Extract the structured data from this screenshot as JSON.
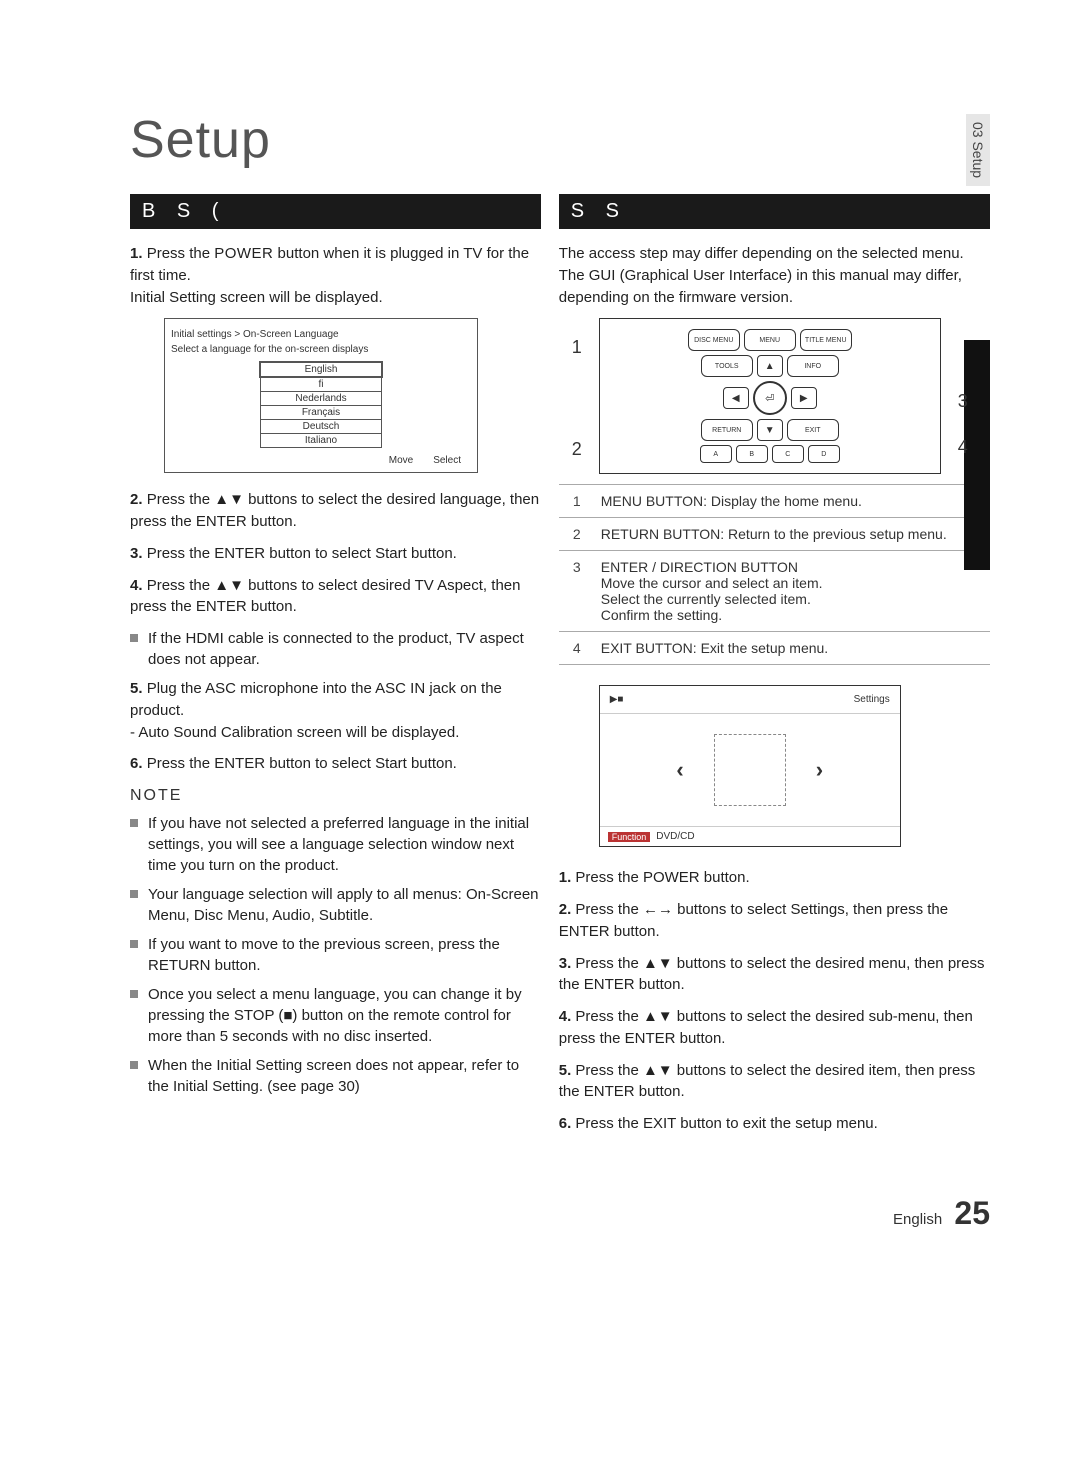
{
  "title": "Setup",
  "side_tab": "03  Setup",
  "left": {
    "bar": "B      S         (",
    "step1_a": "Press the ",
    "power": "POWER",
    "step1_b": " button when it is plugged in TV for the ﬁrst time.",
    "step1_c": "Initial Setting screen will be displayed.",
    "lang": {
      "crumb": "Initial settings > On-Screen Language",
      "instr": "Select a language for the on-screen displays",
      "items": [
        "English",
        "ﬁ",
        "Nederlands",
        "Français",
        "Deutsch",
        "Italiano"
      ],
      "move": "Move",
      "select": "Select"
    },
    "step2": "Press the ▲▼ buttons to select the desired language, then press the ENTER button.",
    "step3": "Press the ENTER button to select Start button.",
    "step4": "Press the ▲▼ buttons to select desired TV Aspect, then press the ENTER button.",
    "step4_note": "If the HDMI cable is connected to the product, TV aspect does not appear.",
    "step5_a": "Plug the ASC microphone into the ASC IN jack on the product.",
    "step5_b": "- Auto Sound Calibration screen will be displayed.",
    "step6": "Press the ENTER button to select Start button.",
    "note_label": "NOTE",
    "notes": [
      "If you have not selected a preferred language in the initial settings, you will see a language selection window next time you turn on the product.",
      "Your language selection will apply to all menus: On-Screen Menu, Disc Menu, Audio, Subtitle.",
      "If you want to move to the previous screen, press the RETURN button.",
      "Once you select a menu language, you can change it by pressing the STOP (■) button on the remote control for more than 5 seconds with no disc inserted.",
      "When the Initial Setting screen does not appear, refer to the Initial Setting. (see page 30)"
    ]
  },
  "right": {
    "bar": "S               S",
    "intro": "The access step may differ depending on the selected menu. The GUI (Graphical User Interface) in this manual may differ, depending on the ﬁrmware version.",
    "remote": {
      "disc_menu": "DISC MENU",
      "menu": "MENU",
      "title_menu": "TITLE MENU",
      "tools": "TOOLS",
      "info": "INFO",
      "return": "RETURN",
      "exit": "EXIT",
      "abcd": [
        "A",
        "B",
        "C",
        "D"
      ],
      "call1": "1",
      "call2": "2",
      "call3": "3",
      "call4": "4"
    },
    "legend": {
      "r1": "MENU BUTTON: Display the home menu.",
      "r2": "RETURN BUTTON: Return to the previous setup menu.",
      "r3_a": "ENTER / DIRECTION BUTTON",
      "r3_b": "Move the cursor and select an item.",
      "r3_c": "Select the currently selected item.",
      "r3_d": "Conﬁrm the setting.",
      "r4": "EXIT BUTTON: Exit the setup menu."
    },
    "settings_box": {
      "playstop": "▶■",
      "settings_label": "Settings",
      "left_chev": "‹",
      "right_chev": "›",
      "footer_tag": "Function",
      "footer_text": "DVD/CD"
    },
    "steps": [
      "Press the POWER button.",
      "Press the ←→ buttons to select Settings, then press the ENTER button.",
      "Press the ▲▼ buttons to select the desired menu, then press the ENTER button.",
      "Press the ▲▼ buttons to select the desired sub-menu, then press the ENTER button.",
      "Press the ▲▼ buttons to select the desired item, then press the ENTER button.",
      "Press the EXIT button to exit the setup menu."
    ]
  },
  "footer": {
    "lang": "English",
    "page": "25"
  }
}
